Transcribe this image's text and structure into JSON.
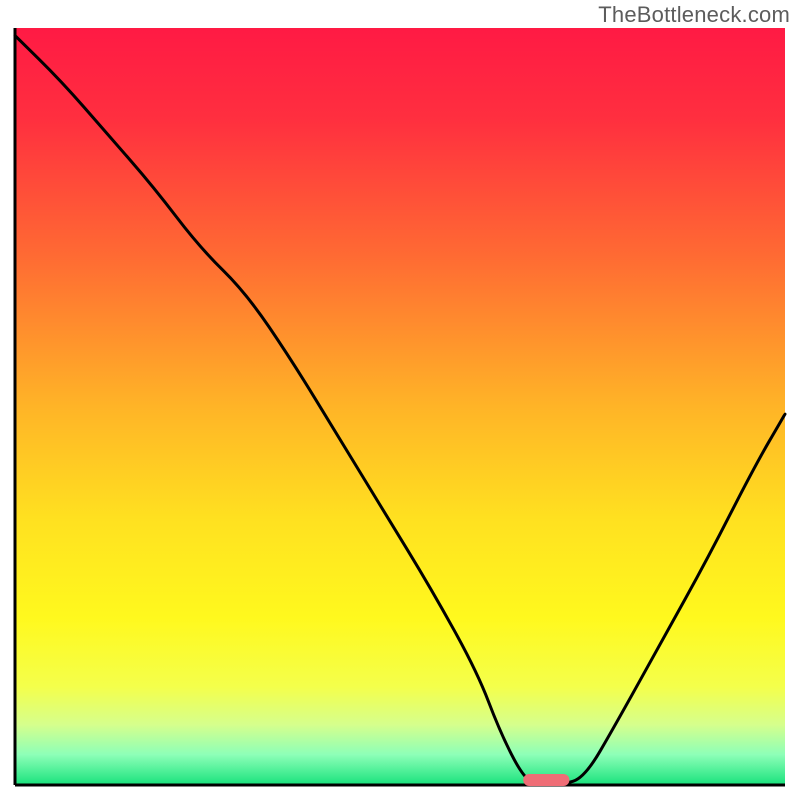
{
  "watermark": "TheBottleneck.com",
  "chart_data": {
    "type": "line",
    "title": "",
    "xlabel": "",
    "ylabel": "",
    "xlim": [
      0,
      100
    ],
    "ylim": [
      0,
      100
    ],
    "grid": false,
    "legend": false,
    "gradient_stops": [
      {
        "pct": 0,
        "color": "#ff1a44"
      },
      {
        "pct": 12,
        "color": "#ff2f3f"
      },
      {
        "pct": 30,
        "color": "#ff6a33"
      },
      {
        "pct": 50,
        "color": "#ffb427"
      },
      {
        "pct": 65,
        "color": "#ffe120"
      },
      {
        "pct": 78,
        "color": "#fff91e"
      },
      {
        "pct": 87,
        "color": "#f4ff4b"
      },
      {
        "pct": 92,
        "color": "#d6ff8c"
      },
      {
        "pct": 96,
        "color": "#8dffb8"
      },
      {
        "pct": 100,
        "color": "#19e27c"
      }
    ],
    "series": [
      {
        "name": "bottleneck-curve",
        "x": [
          0,
          6,
          12,
          18,
          24,
          30,
          36,
          42,
          48,
          54,
          60,
          63,
          66,
          68,
          71,
          74,
          78,
          84,
          90,
          96,
          100
        ],
        "y": [
          99,
          93,
          86,
          79,
          71,
          65,
          56,
          46,
          36,
          26,
          15,
          7,
          1,
          0,
          0,
          1,
          8,
          19,
          30,
          42,
          49
        ]
      }
    ],
    "marker": {
      "name": "optimal-marker",
      "x_start": 66,
      "x_end": 72,
      "y": 0,
      "color": "#ef6d76"
    }
  }
}
